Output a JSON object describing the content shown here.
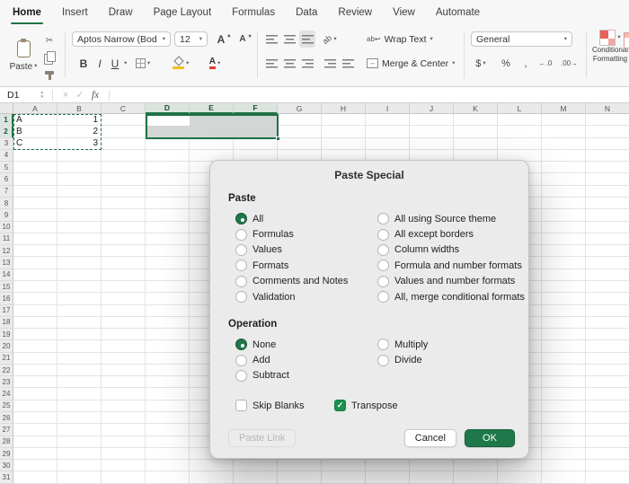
{
  "menu": {
    "tabs": [
      {
        "label": "Home",
        "active": true
      },
      {
        "label": "Insert",
        "active": false
      },
      {
        "label": "Draw",
        "active": false
      },
      {
        "label": "Page Layout",
        "active": false
      },
      {
        "label": "Formulas",
        "active": false
      },
      {
        "label": "Data",
        "active": false
      },
      {
        "label": "Review",
        "active": false
      },
      {
        "label": "View",
        "active": false
      },
      {
        "label": "Automate",
        "active": false
      }
    ]
  },
  "ribbon": {
    "paste_label": "Paste",
    "font_name": "Aptos Narrow (Bod...",
    "font_size": "12",
    "bold": "B",
    "italic": "I",
    "underline": "U",
    "wrap_text_label": "Wrap Text",
    "merge_center_label": "Merge & Center",
    "number_format": "General",
    "currency": "$",
    "percent": "%",
    "comma": ",",
    "conditional_line1": "Conditional",
    "conditional_line2": "Formatting",
    "icons": {
      "cut": "✂",
      "wrap_glyph": "ab↩",
      "orientation_glyph": "ab",
      "merge_arrow": "↔",
      "inc_decimal": "←.0",
      "dec_decimal": ".00→"
    }
  },
  "formula_bar": {
    "name_box": "D1",
    "fx_label": "fx"
  },
  "grid": {
    "columns": [
      "A",
      "B",
      "C",
      "D",
      "E",
      "F",
      "G",
      "H",
      "I",
      "J",
      "K",
      "L",
      "M",
      "N"
    ],
    "row_count": 31,
    "cells": {
      "A1": "A",
      "B1": "1",
      "A2": "B",
      "B2": "2",
      "A3": "C",
      "B3": "3"
    },
    "selected_columns": [
      "D",
      "E",
      "F"
    ],
    "selected_rows": [
      1,
      2
    ],
    "copy_range": "A1:B3",
    "selection_range": "D1:F2"
  },
  "dialog": {
    "title": "Paste Special",
    "paste_label": "Paste",
    "paste_options": {
      "left": [
        {
          "label": "All",
          "selected": true
        },
        {
          "label": "Formulas",
          "selected": false
        },
        {
          "label": "Values",
          "selected": false
        },
        {
          "label": "Formats",
          "selected": false
        },
        {
          "label": "Comments and Notes",
          "selected": false
        },
        {
          "label": "Validation",
          "selected": false
        }
      ],
      "right": [
        {
          "label": "All using Source theme",
          "selected": false
        },
        {
          "label": "All except borders",
          "selected": false
        },
        {
          "label": "Column widths",
          "selected": false
        },
        {
          "label": "Formula and number formats",
          "selected": false
        },
        {
          "label": "Values and number formats",
          "selected": false
        },
        {
          "label": "All, merge conditional formats",
          "selected": false
        }
      ]
    },
    "operation_label": "Operation",
    "operation_options": {
      "left": [
        {
          "label": "None",
          "selected": true
        },
        {
          "label": "Add",
          "selected": false
        },
        {
          "label": "Subtract",
          "selected": false
        }
      ],
      "right": [
        {
          "label": "Multiply",
          "selected": false
        },
        {
          "label": "Divide",
          "selected": false
        }
      ]
    },
    "skip_blanks": {
      "label": "Skip Blanks",
      "checked": false
    },
    "transpose": {
      "label": "Transpose",
      "checked": true
    },
    "buttons": {
      "paste_link": "Paste Link",
      "cancel": "Cancel",
      "ok": "OK"
    }
  },
  "colors": {
    "accent": "#217346",
    "selection_fill": "#d2d6d4",
    "ok_button": "#1f7849"
  }
}
